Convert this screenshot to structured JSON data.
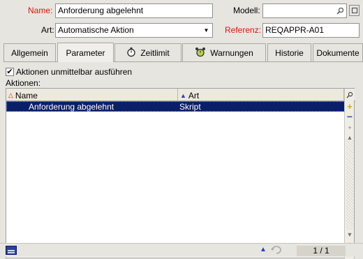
{
  "form": {
    "name_label": "Name:",
    "name_value": "Anforderung abgelehnt",
    "modell_label": "Modell:",
    "modell_value": "",
    "art_label": "Art:",
    "art_value": "Automatische Aktion",
    "referenz_label": "Referenz:",
    "referenz_value": "REQAPPR-A01"
  },
  "tabs": [
    {
      "label": "Allgemein",
      "icon": null,
      "active": false
    },
    {
      "label": "Parameter",
      "icon": null,
      "active": true
    },
    {
      "label": "Zeitlimit",
      "icon": "stopwatch-icon",
      "active": false
    },
    {
      "label": "Warnungen",
      "icon": "alarm-clock-icon",
      "active": false
    },
    {
      "label": "Historie",
      "icon": null,
      "active": false
    },
    {
      "label": "Dokumente",
      "icon": null,
      "active": false
    }
  ],
  "options": {
    "execute_label": "Aktionen unmittelbar ausführen",
    "execute_checked": true,
    "actions_label": "Aktionen:"
  },
  "grid": {
    "columns": [
      "Name",
      "Art"
    ],
    "rows": [
      {
        "name": "Anforderung abgelehnt",
        "art": "Skript",
        "selected": true
      }
    ]
  },
  "status": {
    "counter": "1 / 1"
  },
  "colors": {
    "required_label": "#d9170c",
    "selection": "#0b1f67",
    "background": "#e7e5df"
  }
}
